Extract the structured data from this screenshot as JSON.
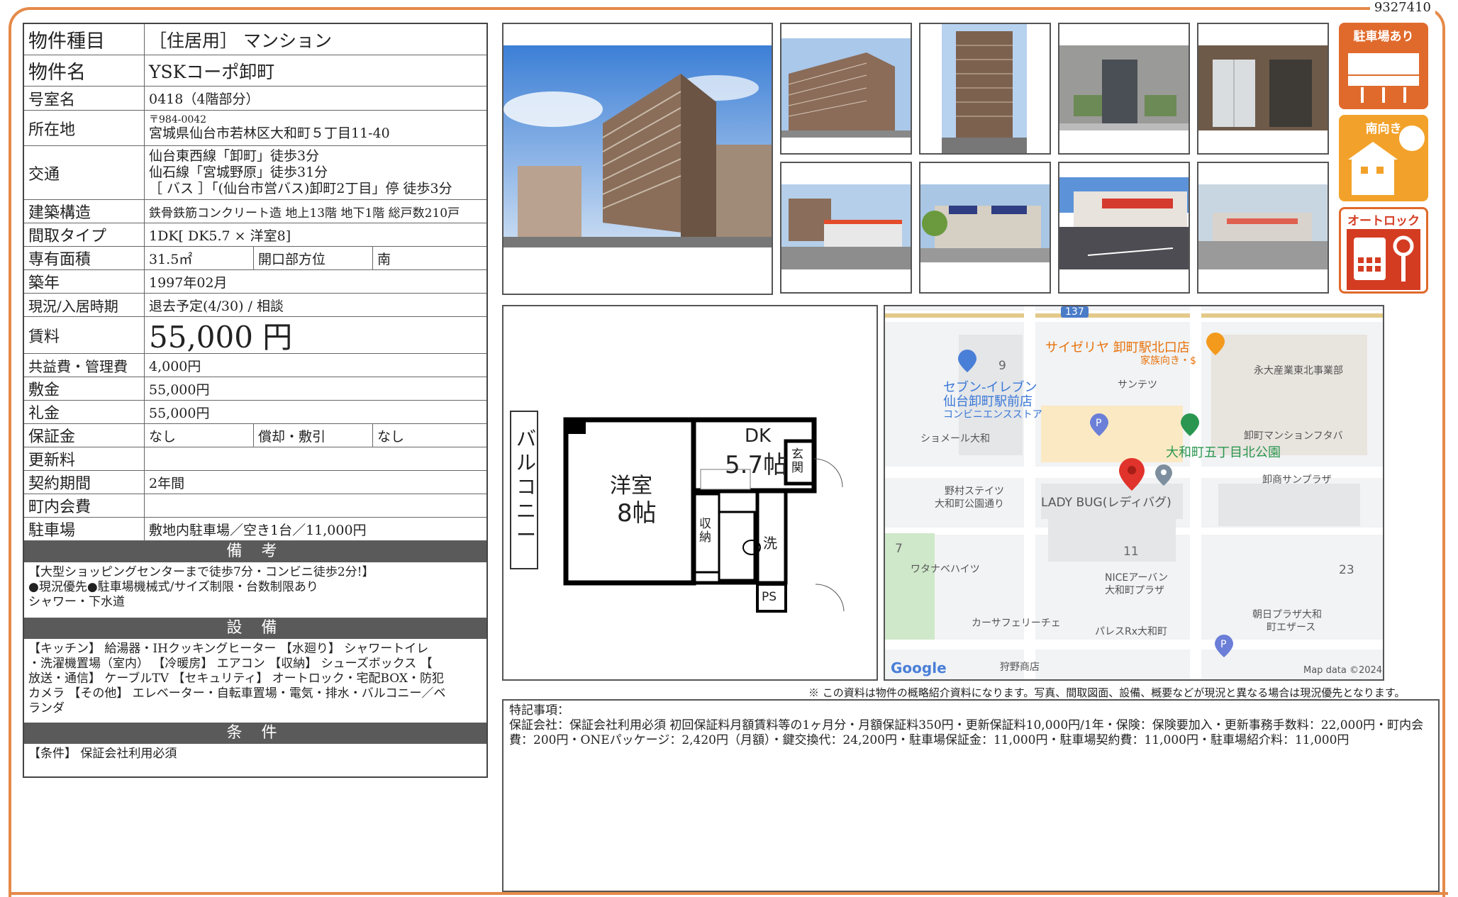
{
  "doc_id": "9327410",
  "info": {
    "type_label": "物件種目",
    "type_value": "［住居用］ マンション",
    "name_label": "物件名",
    "name_value": "YSKコーポ卸町",
    "room_label": "号室名",
    "room_value": "0418（4階部分）",
    "address_label": "所在地",
    "address_zip": "〒984-0042",
    "address_value": "宮城県仙台市若林区大和町５丁目11-40",
    "transport_label": "交通",
    "transport": [
      "仙台東西線「卸町」徒歩3分",
      "仙石線「宮城野原」徒歩31分",
      "［ バス ］「(仙台市営バス)卸町2丁目」停 徒歩3分"
    ],
    "structure_label": "建築構造",
    "structure_value": "鉄骨鉄筋コンクリート造 地上13階 地下1階 総戸数210戸",
    "layout_label": "間取タイプ",
    "layout_value": "1DK[ DK5.7 × 洋室8]",
    "area_label": "専有面積",
    "area_value": "31.5㎡",
    "direction_label": "開口部方位",
    "direction_value": "南",
    "built_label": "築年",
    "built_value": "1997年02月",
    "status_label": "現況/入居時期",
    "status_value": "退去予定(4/30) / 相談",
    "rent_label": "賃料",
    "rent_value": "55,000 円",
    "fee_label": "共益費・管理費",
    "fee_value": "4,000円",
    "deposit_label": "敷金",
    "deposit_value": "55,000円",
    "key_money_label": "礼金",
    "key_money_value": "55,000円",
    "guarantee_label": "保証金",
    "guarantee_value": "なし",
    "amort_label": "償却・敷引",
    "amort_value": "なし",
    "renewal_label": "更新料",
    "renewal_value": "",
    "contract_label": "契約期間",
    "contract_value": "2年間",
    "town_fee_label": "町内会費",
    "town_fee_value": "",
    "parking_label": "駐車場",
    "parking_value": "敷地内駐車場／空き1台／11,000円"
  },
  "remarks": {
    "title": "備 考",
    "text": "【大型ショッピングセンターまで徒歩7分・コンビニ徒歩2分!】\n●現況優先●駐車場機械式/サイズ制限・台数制限あり\nシャワー・下水道"
  },
  "equipment": {
    "title": "設 備",
    "text": "【キッチン】 給湯器・IHクッキングヒーター 【水廻り】 シャワートイレ\n・洗濯機置場（室内） 【冷暖房】 エアコン 【収納】 シューズボックス 【\n放送・通信】 ケーブルTV 【セキュリティ】 オートロック・宅配BOX・防犯\nカメラ 【その他】 エレベーター・自転車置場・電気・排水・バルコニー／ベ\nランダ"
  },
  "conditions": {
    "title": "条 件",
    "text": "【条件】 保証会社利用必須"
  },
  "badges": [
    "駐車場あり",
    "南向き",
    "オートロック"
  ],
  "floorplan": {
    "balcony": "バルコニー",
    "western_room": "洋室",
    "western_size": "8帖",
    "dk": "DK",
    "dk_size": "5.7帖",
    "entrance": "玄関",
    "storage": "収納",
    "wash": "洗",
    "ps": "PS"
  },
  "map": {
    "road_number": "137",
    "labels": {
      "saizeriya": "サイゼリヤ 卸町駅北口店",
      "saizeriya_sub": "家族向き・$",
      "seven": "セブン-イレブン",
      "seven2": "仙台卸町駅前店",
      "seven_sub": "コンビニエンスストア",
      "santetsu": "サンテツ",
      "eidai": "永大産業東北事業部",
      "shomeru": "ショメール大和",
      "oroshi_mansion": "卸町マンションフタバ",
      "park": "大和町五丁目北公園",
      "oroshi_sunplaza": "卸商サンプラザ",
      "nomura": "野村ステイツ",
      "nomura2": "大和町公園通り",
      "ladybug": "LADY BUG(レディバグ)",
      "watanabe": "ワタナベハイツ",
      "nice": "NICEアーバン",
      "nice2": "大和町プラザ",
      "asahi": "朝日プラザ大和",
      "asahi2": "町エザース",
      "car": "カーサフェリーチェ",
      "palace": "パレスRx大和町",
      "kariya": "狩野商店",
      "google": "Google",
      "mapdata": "Map data ©2024"
    },
    "nums": [
      "9",
      "11",
      "7",
      "23"
    ]
  },
  "disclaimer": "※ この資料は物件の概略紹介資料になります。写真、間取図面、設備、概要などが現況と異なる場合は現況優先となります。",
  "notes_title": "特記事項：",
  "notes_text": "保証会社：保証会社利用必須 初回保証料月額賃料等の1ヶ月分・月額保証料350円・更新保証料10,000円/1年・保険：保険要加入・更新事務手数料：22,000円・町内会費：200円・ONEパッケージ：2,420円（月額）・鍵交換代：24,200円・駐車場保証金：11,000円・駐車場契約費：11,000円・駐車場紹介料：11,000円"
}
